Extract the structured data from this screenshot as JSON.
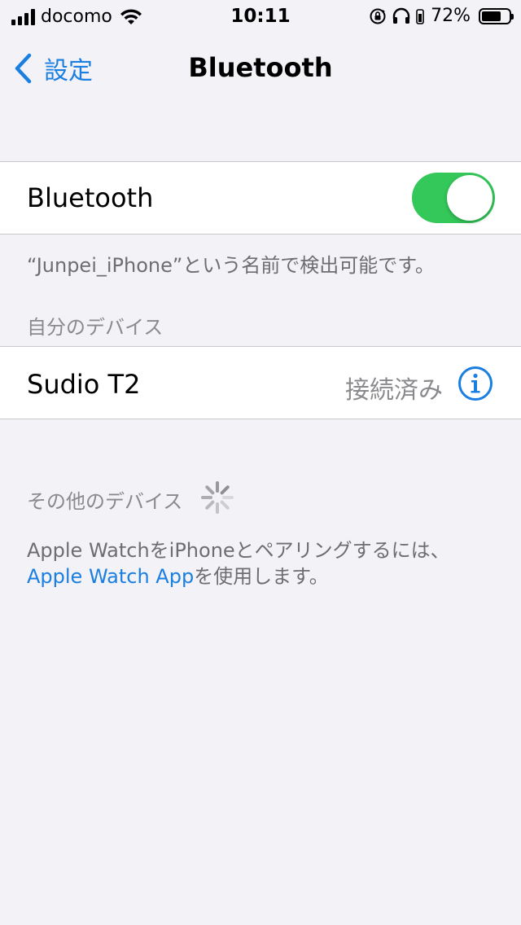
{
  "status_bar": {
    "carrier": "docomo",
    "time": "10:11",
    "battery_percent": "72%",
    "battery_level": 0.72,
    "icons": [
      "signal-icon",
      "wifi-icon",
      "rotation-lock-icon",
      "headphones-icon",
      "battery-icon"
    ]
  },
  "nav": {
    "back_label": "設定",
    "title": "Bluetooth"
  },
  "bluetooth_toggle": {
    "label": "Bluetooth",
    "on": true,
    "color": "#34c759"
  },
  "discoverable_text": "“Junpei_iPhone”という名前で検出可能です。",
  "my_devices": {
    "header": "自分のデバイス",
    "items": [
      {
        "name": "Sudio T2",
        "status": "接続済み"
      }
    ]
  },
  "other_devices": {
    "header": "その他のデバイス",
    "loading": true
  },
  "apple_watch": {
    "text_line1": "Apple WatchをiPhoneとペアリングするには、",
    "link_text": "Apple Watch App",
    "text_after_link": "を使用します。"
  },
  "colors": {
    "accent": "#1a7fe0",
    "background": "#f2f2f7",
    "secondary_text": "#8a8a8e"
  }
}
